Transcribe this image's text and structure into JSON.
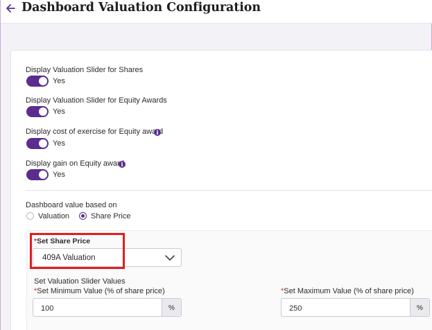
{
  "header": {
    "title": "Dashboard Valuation Configuration",
    "back_icon": "arrow-left-icon"
  },
  "colors": {
    "accent": "#5b2d8e",
    "required": "#d0312d",
    "highlight": "#e01e1e"
  },
  "settings": [
    {
      "label": "Display Valuation Slider for Shares",
      "state": "Yes",
      "on": true,
      "info": false
    },
    {
      "label": "Display Valuation Slider for Equity Awards",
      "state": "Yes",
      "on": true,
      "info": false
    },
    {
      "label": "Display cost of exercise for Equity award",
      "state": "Yes",
      "on": true,
      "info": true
    },
    {
      "label": "Display gain on Equity award",
      "state": "Yes",
      "on": true,
      "info": true
    }
  ],
  "value_basis": {
    "label": "Dashboard value based on",
    "options": [
      {
        "label": "Valuation",
        "selected": false
      },
      {
        "label": "Share Price",
        "selected": true
      }
    ]
  },
  "share_price": {
    "required_mark": "*",
    "label": "Set Share Price",
    "selected": "409A Valuation"
  },
  "slider_values": {
    "heading": "Set Valuation Slider Values",
    "min": {
      "required_mark": "*",
      "label": "Set Minimum Value (% of share price)",
      "value": "100",
      "unit": "%"
    },
    "max": {
      "required_mark": "*",
      "label": "Set Maximum Value (% of share price)",
      "value": "250",
      "unit": "%"
    }
  }
}
